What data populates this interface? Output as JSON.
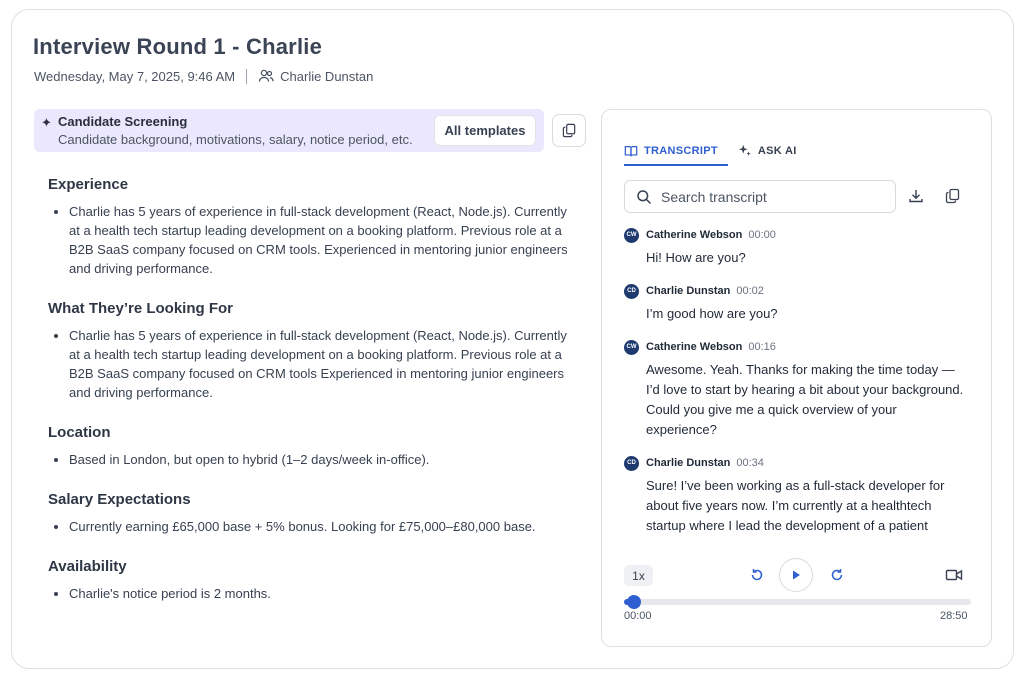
{
  "header": {
    "title": "Interview Round 1 - Charlie",
    "datetime": "Wednesday, May 7, 2025, 9:46 AM",
    "participant": "Charlie Dunstan"
  },
  "template": {
    "title": "Candidate Screening",
    "subtitle": "Candidate background, motivations, salary, notice period, etc.",
    "all_templates_label": "All templates"
  },
  "notes": [
    {
      "heading": "Experience",
      "bullets": [
        "Charlie has 5 years of experience in full-stack development (React, Node.js). Currently at a health tech startup leading development on a booking platform. Previous role at a B2B SaaS company focused on CRM tools. Experienced in mentoring junior engineers and driving performance."
      ]
    },
    {
      "heading": "What They’re Looking For",
      "bullets": [
        "Charlie has 5 years of experience in full-stack development (React, Node.js). Currently at a health tech startup leading development on a booking platform. Previous role at a B2B SaaS company focused on CRM tools Experienced in mentoring junior engineers and driving performance."
      ]
    },
    {
      "heading": "Location",
      "bullets": [
        "Based in London, but open to hybrid (1–2 days/week in-office)."
      ]
    },
    {
      "heading": "Salary Expectations",
      "bullets": [
        "Currently earning £65,000 base + 5% bonus. Looking for £75,000–£80,000 base."
      ]
    },
    {
      "heading": "Availability",
      "bullets": [
        "Charlie's notice period is 2 months."
      ]
    }
  ],
  "panel": {
    "tabs": [
      {
        "label": "TRANSCRIPT",
        "icon": "book-icon",
        "active": true
      },
      {
        "label": "ASK AI",
        "icon": "sparkle-icon",
        "active": false
      }
    ],
    "search_placeholder": "Search transcript",
    "messages": [
      {
        "initials": "CW",
        "speaker": "Catherine Webson",
        "time": "00:00",
        "text": "Hi! How are you?"
      },
      {
        "initials": "CD",
        "speaker": "Charlie Dunstan",
        "time": "00:02",
        "text": "I’m good how are you?"
      },
      {
        "initials": "CW",
        "speaker": "Catherine Webson",
        "time": "00:16",
        "text": "Awesome. Yeah. Thanks for making the time today — I’d love to start by hearing a bit about your background. Could you give me a quick overview of your experience?"
      },
      {
        "initials": "CD",
        "speaker": "Charlie Dunstan",
        "time": "00:34",
        "text": "Sure! I’ve been working as a full-stack developer for about five years now. I’m currently at a healthtech startup where I lead the development of a patient booking system. Before that, I was at a mid-sized"
      }
    ],
    "player": {
      "speed": "1x",
      "current_time": "00:00",
      "duration": "28:50",
      "progress_fraction": 0.03
    },
    "accent_color": "#2f5fd0"
  }
}
